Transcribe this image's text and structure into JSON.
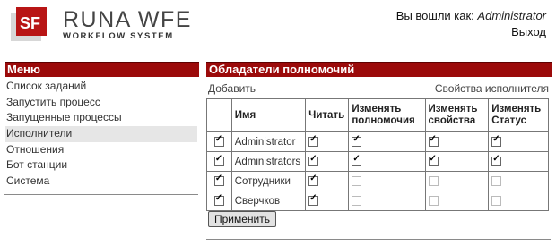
{
  "header": {
    "logo_title": "RUNA WFE",
    "logo_sub": "WORKFLOW SYSTEM",
    "login_prefix": "Вы вошли как:",
    "login_user": "Administrator",
    "logout_label": "Выход"
  },
  "sidebar": {
    "title": "Меню",
    "items": [
      {
        "label": "Список заданий"
      },
      {
        "label": "Запустить процесс"
      },
      {
        "label": "Запущенные процессы"
      },
      {
        "label": "Исполнители"
      },
      {
        "label": "Отношения"
      },
      {
        "label": "Бот станции"
      },
      {
        "label": "Система"
      }
    ]
  },
  "main": {
    "title": "Обладатели полномочий",
    "add_label": "Добавить",
    "props_label": "Свойства исполнителя",
    "columns": [
      "Имя",
      "Читать",
      "Изменять полномочия",
      "Изменять свойства",
      "Изменять Статус"
    ],
    "rows": [
      {
        "selected": true,
        "name": "Administrator",
        "perms": [
          true,
          true,
          true,
          true
        ],
        "enabled": true
      },
      {
        "selected": true,
        "name": "Administrators",
        "perms": [
          true,
          true,
          true,
          true
        ],
        "enabled": true
      },
      {
        "selected": true,
        "name": "Сотрудники",
        "perms": [
          true,
          false,
          false,
          false
        ],
        "enabled": true
      },
      {
        "selected": true,
        "name": "Сверчков",
        "perms": [
          true,
          false,
          false,
          false
        ],
        "enabled": true
      }
    ],
    "apply_label": "Применить"
  },
  "colors": {
    "accent": "#9b0a0a"
  }
}
